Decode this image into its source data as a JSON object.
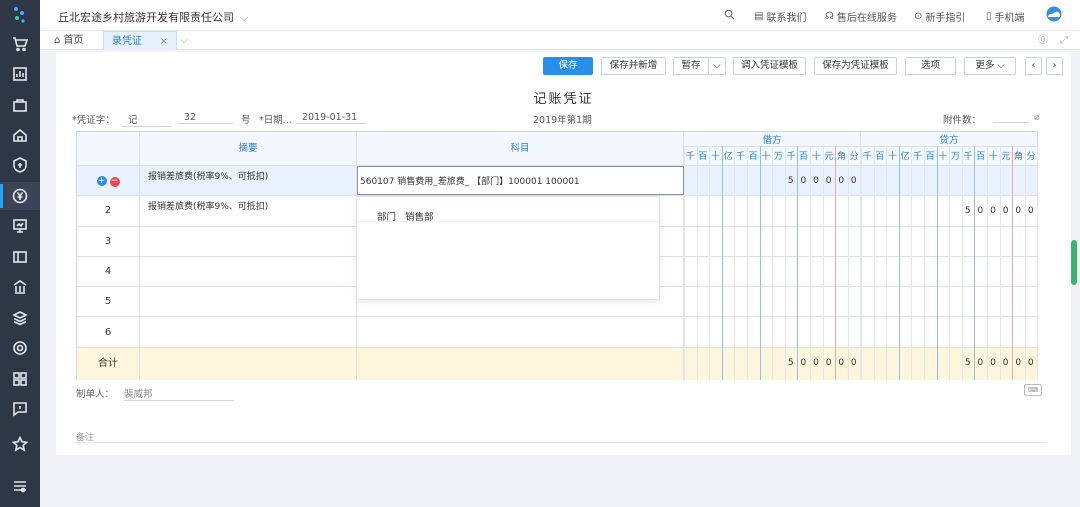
{
  "topbar": {
    "company": "丘北宏途乡村旅游开发有限责任公司",
    "links": [
      "联系我们",
      "售后在线服务",
      "新手指引",
      "手机端"
    ]
  },
  "tabs": [
    {
      "label": "首页",
      "active": false
    },
    {
      "label": "录凭证",
      "active": true
    }
  ],
  "toolbar": {
    "save": "保存",
    "save_new": "保存并新增",
    "hold": "暂存",
    "import_template": "调入凭证模板",
    "save_template": "保存为凭证模板",
    "options": "选项",
    "more": "更多"
  },
  "voucher": {
    "title": "记账凭证",
    "word_label": "*凭证字：",
    "word_value": "记",
    "number_value": "32",
    "number_suffix": "号",
    "date_label": "*日期...",
    "date_value": "2019-01-31",
    "period": "2019年第1期",
    "attach_label": "附件数："
  },
  "table": {
    "header": {
      "summary": "摘要",
      "account": "科目",
      "debit": "借方",
      "credit": "贷方",
      "digits": [
        "千",
        "百",
        "十",
        "亿",
        "千",
        "百",
        "十",
        "万",
        "千",
        "百",
        "十",
        "元",
        "角",
        "分"
      ]
    },
    "rows": [
      {
        "no": "",
        "summary": "报销差旅费(税率9%、可抵扣)",
        "account": "560107 销售费用_差旅费_ 【部门】100001 100001",
        "debit": "500000",
        "credit": ""
      },
      {
        "no": "2",
        "summary": "报销差旅费(税率9%、可抵扣)",
        "account": "",
        "debit": "",
        "credit": "500000"
      },
      {
        "no": "3",
        "summary": "",
        "account": "",
        "debit": "",
        "credit": ""
      },
      {
        "no": "4",
        "summary": "",
        "account": "",
        "debit": "",
        "credit": ""
      },
      {
        "no": "5",
        "summary": "",
        "account": "",
        "debit": "",
        "credit": ""
      },
      {
        "no": "6",
        "summary": "",
        "account": "",
        "debit": "",
        "credit": ""
      }
    ],
    "total_label": "合计",
    "total_debit": "500000",
    "total_credit": "500000"
  },
  "popup": {
    "label": "部门",
    "value": "销售部"
  },
  "footer": {
    "maker_label": "制单人：",
    "maker_value": "裴威邦",
    "remark_placeholder": "备注"
  },
  "colors": {
    "accent": "#2a8fe8",
    "sidebar": "#2e3746",
    "total_bg": "#fdf6dc"
  }
}
